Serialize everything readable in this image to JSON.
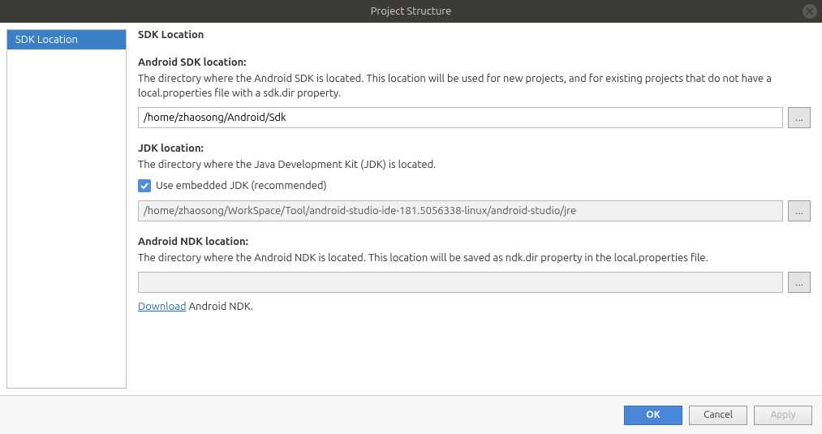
{
  "window": {
    "title": "Project Structure"
  },
  "sidebar": {
    "items": [
      {
        "label": "SDK Location"
      }
    ]
  },
  "main": {
    "heading": "SDK Location",
    "sdk": {
      "label": "Android SDK location:",
      "desc": "The directory where the Android SDK is located. This location will be used for new projects, and for existing projects that do not have a local.properties file with a sdk.dir property.",
      "value": "/home/zhaosong/Android/Sdk",
      "browse": "..."
    },
    "jdk": {
      "label": "JDK location:",
      "desc": "The directory where the Java Development Kit (JDK) is located.",
      "checkbox_label": "Use embedded JDK (recommended)",
      "value": "/home/zhaosong/WorkSpace/Tool/android-studio-ide-181.5056338-linux/android-studio/jre",
      "browse": "..."
    },
    "ndk": {
      "label": "Android NDK location:",
      "desc": "The directory where the Android NDK is located. This location will be saved as ndk.dir property in the local.properties file.",
      "value": "",
      "browse": "...",
      "download_link": "Download",
      "download_suffix": " Android NDK."
    }
  },
  "footer": {
    "ok": "OK",
    "cancel": "Cancel",
    "apply": "Apply"
  }
}
